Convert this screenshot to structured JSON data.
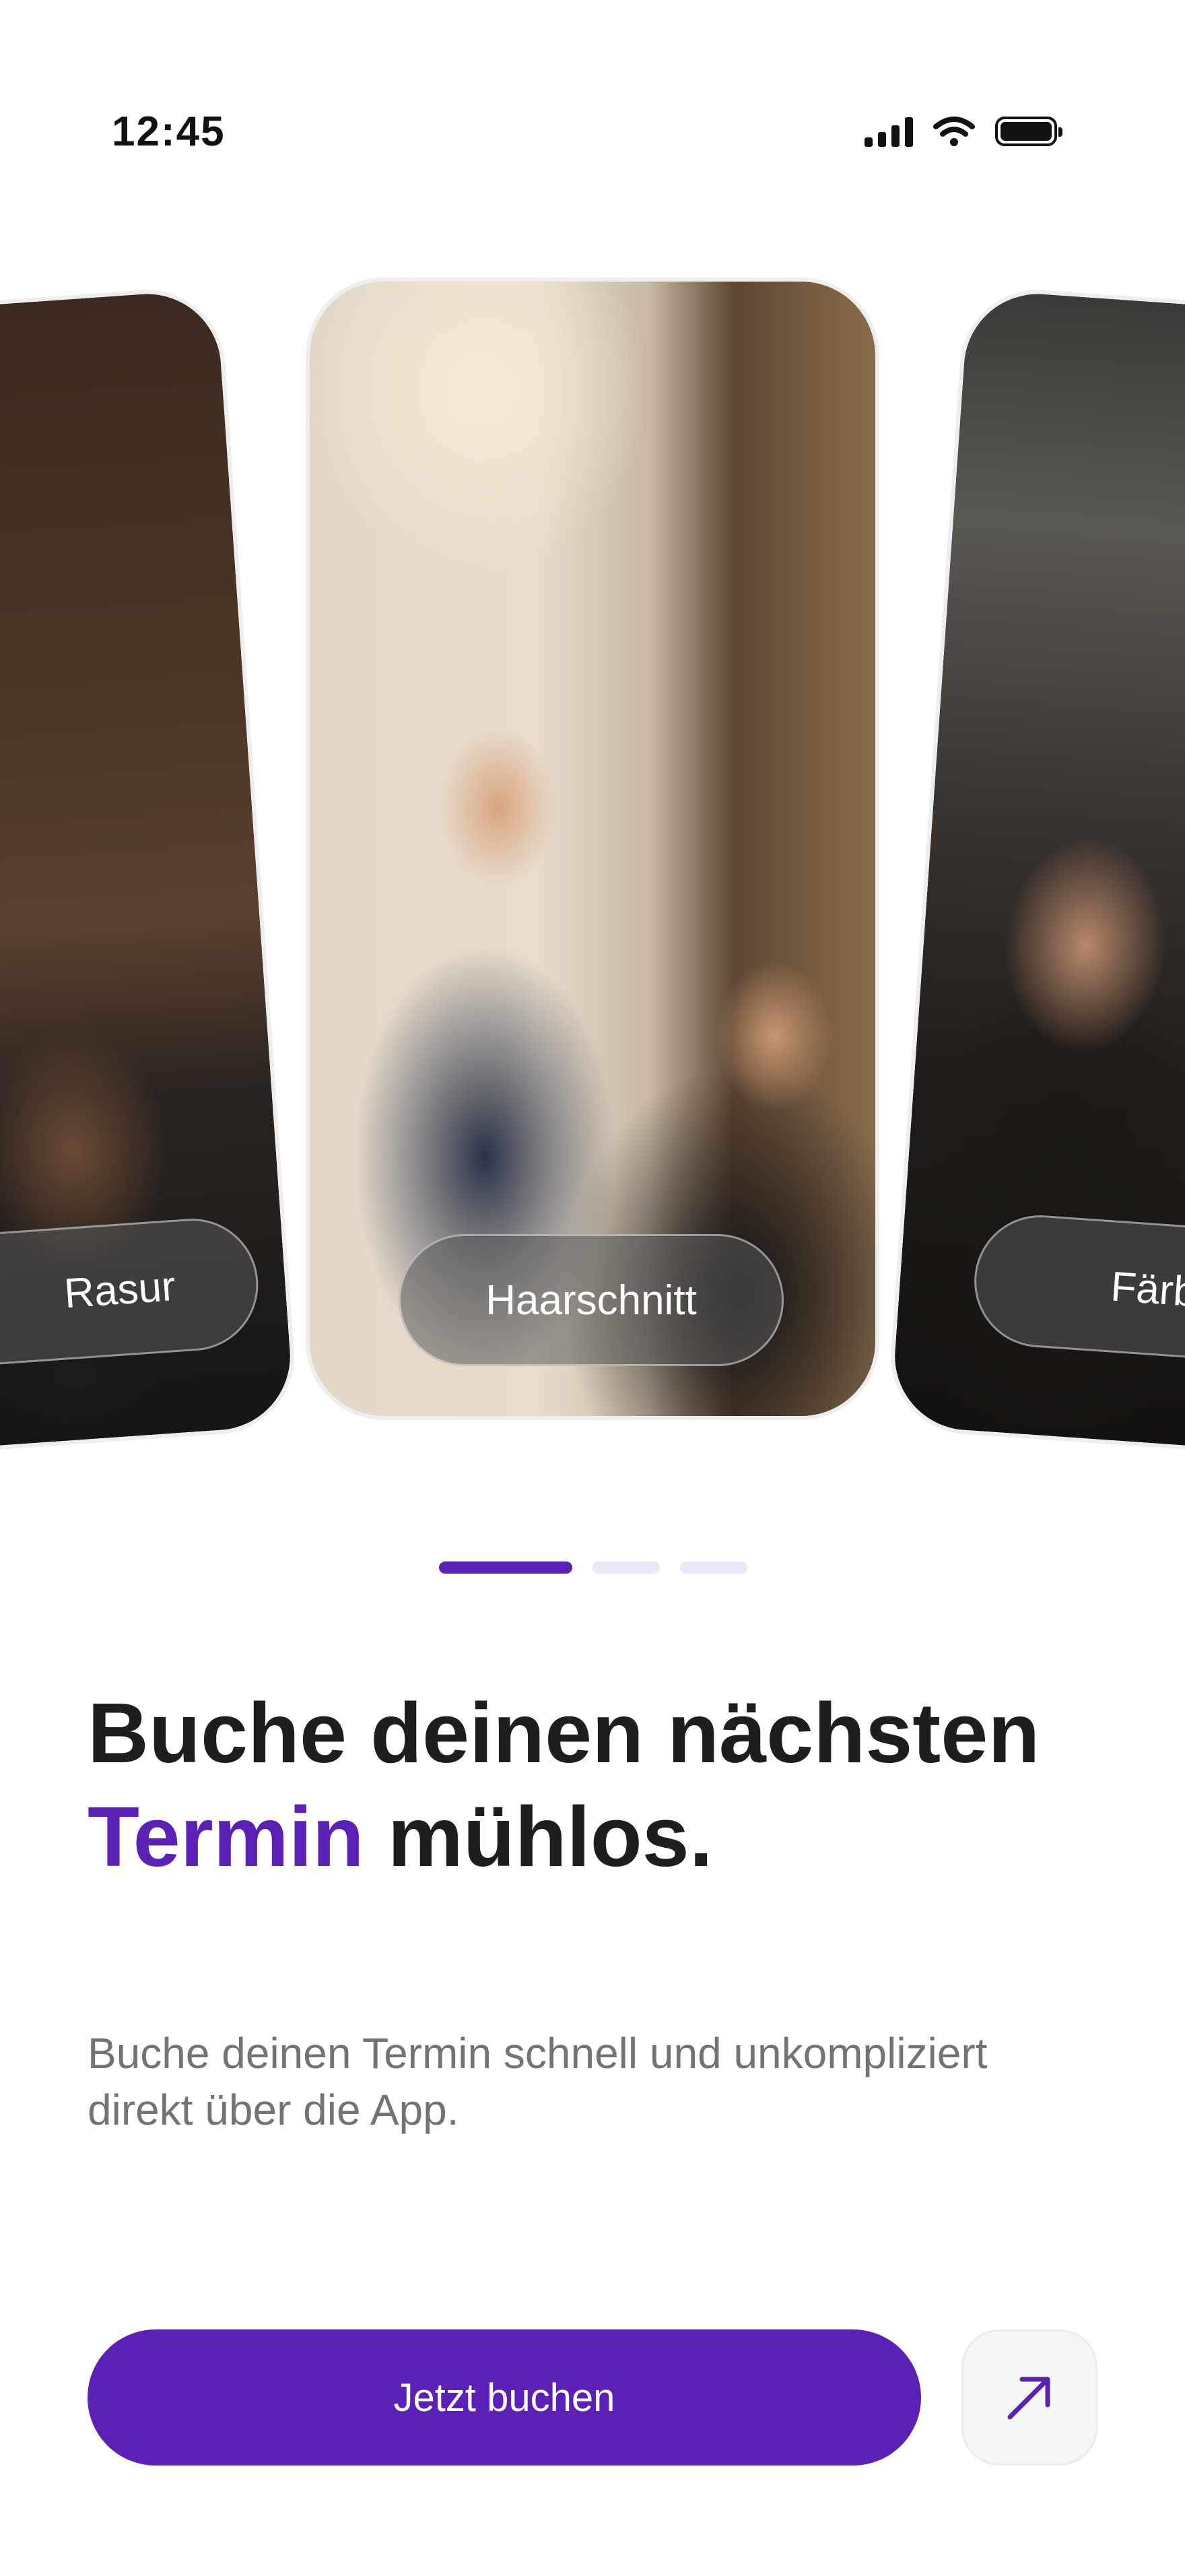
{
  "status_bar": {
    "time": "12:45",
    "icons": [
      "cellular-signal-icon",
      "wifi-icon",
      "battery-icon"
    ]
  },
  "carousel": {
    "cards": [
      {
        "label": "Rasur",
        "image": "barber-shaving-beard-photo"
      },
      {
        "label": "Haarschnitt",
        "image": "barber-cutting-hair-photo"
      },
      {
        "label": "Färben",
        "image": "barber-coloring-hair-photo"
      }
    ],
    "active_index": 1,
    "page_count": 3
  },
  "headline": {
    "part1": "Buche deinen nächsten ",
    "accent": "Termin",
    "part2": " mühlos."
  },
  "subtitle": "Buche deinen Termin schnell und unkompliziert direkt über die App.",
  "actions": {
    "book_label": "Jetzt buchen",
    "secondary_icon": "arrow-up-right-icon"
  },
  "colors": {
    "accent": "#5B21B6",
    "dot_inactive": "#E6E9F7",
    "text_dark": "#1E1E1E",
    "text_muted": "#737373"
  }
}
